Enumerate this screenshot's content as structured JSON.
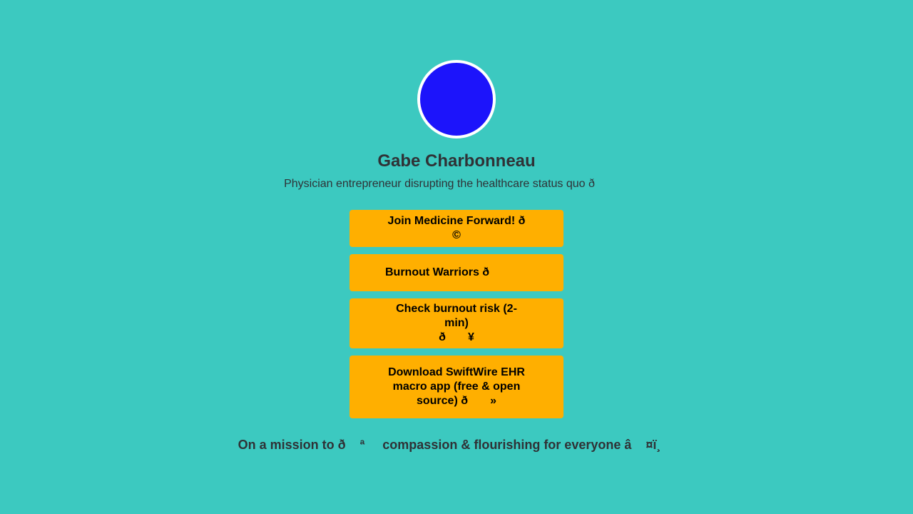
{
  "profile": {
    "name": "Gabe Charbonneau",
    "bio": "Physician entrepreneur disrupting the healthcare status quo ð",
    "avatar_color": "#1c14fb"
  },
  "links": [
    {
      "label": "Join Medicine Forward! ð       ©"
    },
    {
      "label": "Burnout Warriors ð                "
    },
    {
      "label": "Check burnout risk (2-min)\nð       ¥"
    },
    {
      "label": "Download SwiftWire EHR macro app (free & open source) ð       »"
    }
  ],
  "footer": {
    "text": "On a mission to ð    ª     compassion & flourishing for everyone â    ¤ï¸"
  },
  "colors": {
    "background": "#3cc9c0",
    "button": "#ffaf00",
    "text": "#2f3236"
  }
}
